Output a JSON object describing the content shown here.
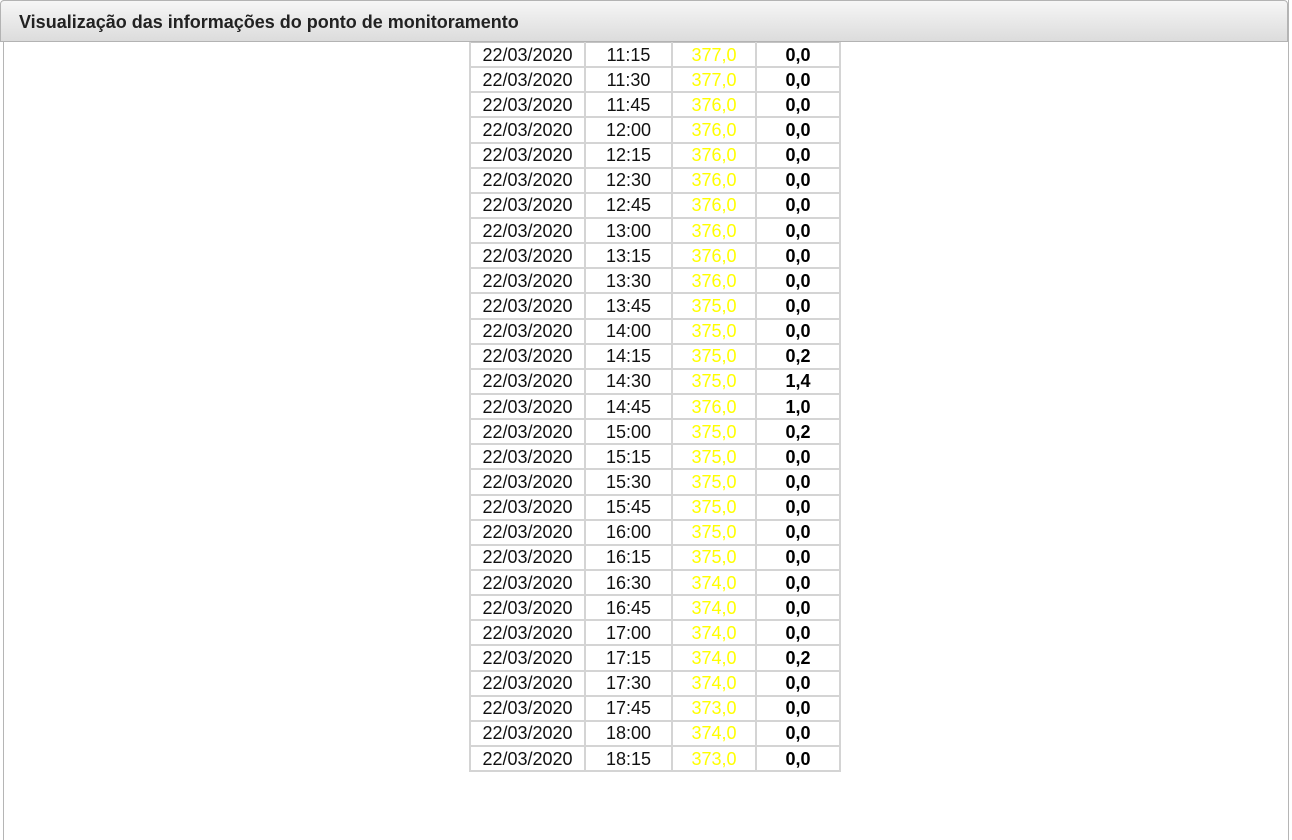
{
  "panel": {
    "title": "Visualização das informações do ponto de monitoramento"
  },
  "colors": {
    "level_text": "#ffff00",
    "header_bg": "#e6e6e6",
    "grid": "#d4d4d4"
  },
  "rows": [
    {
      "date": "22/03/2020",
      "time": "11:15",
      "level": "377,0",
      "rain": "0,0"
    },
    {
      "date": "22/03/2020",
      "time": "11:30",
      "level": "377,0",
      "rain": "0,0"
    },
    {
      "date": "22/03/2020",
      "time": "11:45",
      "level": "376,0",
      "rain": "0,0"
    },
    {
      "date": "22/03/2020",
      "time": "12:00",
      "level": "376,0",
      "rain": "0,0"
    },
    {
      "date": "22/03/2020",
      "time": "12:15",
      "level": "376,0",
      "rain": "0,0"
    },
    {
      "date": "22/03/2020",
      "time": "12:30",
      "level": "376,0",
      "rain": "0,0"
    },
    {
      "date": "22/03/2020",
      "time": "12:45",
      "level": "376,0",
      "rain": "0,0"
    },
    {
      "date": "22/03/2020",
      "time": "13:00",
      "level": "376,0",
      "rain": "0,0"
    },
    {
      "date": "22/03/2020",
      "time": "13:15",
      "level": "376,0",
      "rain": "0,0"
    },
    {
      "date": "22/03/2020",
      "time": "13:30",
      "level": "376,0",
      "rain": "0,0"
    },
    {
      "date": "22/03/2020",
      "time": "13:45",
      "level": "375,0",
      "rain": "0,0"
    },
    {
      "date": "22/03/2020",
      "time": "14:00",
      "level": "375,0",
      "rain": "0,0"
    },
    {
      "date": "22/03/2020",
      "time": "14:15",
      "level": "375,0",
      "rain": "0,2"
    },
    {
      "date": "22/03/2020",
      "time": "14:30",
      "level": "375,0",
      "rain": "1,4"
    },
    {
      "date": "22/03/2020",
      "time": "14:45",
      "level": "376,0",
      "rain": "1,0"
    },
    {
      "date": "22/03/2020",
      "time": "15:00",
      "level": "375,0",
      "rain": "0,2"
    },
    {
      "date": "22/03/2020",
      "time": "15:15",
      "level": "375,0",
      "rain": "0,0"
    },
    {
      "date": "22/03/2020",
      "time": "15:30",
      "level": "375,0",
      "rain": "0,0"
    },
    {
      "date": "22/03/2020",
      "time": "15:45",
      "level": "375,0",
      "rain": "0,0"
    },
    {
      "date": "22/03/2020",
      "time": "16:00",
      "level": "375,0",
      "rain": "0,0"
    },
    {
      "date": "22/03/2020",
      "time": "16:15",
      "level": "375,0",
      "rain": "0,0"
    },
    {
      "date": "22/03/2020",
      "time": "16:30",
      "level": "374,0",
      "rain": "0,0"
    },
    {
      "date": "22/03/2020",
      "time": "16:45",
      "level": "374,0",
      "rain": "0,0"
    },
    {
      "date": "22/03/2020",
      "time": "17:00",
      "level": "374,0",
      "rain": "0,0"
    },
    {
      "date": "22/03/2020",
      "time": "17:15",
      "level": "374,0",
      "rain": "0,2"
    },
    {
      "date": "22/03/2020",
      "time": "17:30",
      "level": "374,0",
      "rain": "0,0"
    },
    {
      "date": "22/03/2020",
      "time": "17:45",
      "level": "373,0",
      "rain": "0,0"
    },
    {
      "date": "22/03/2020",
      "time": "18:00",
      "level": "374,0",
      "rain": "0,0"
    },
    {
      "date": "22/03/2020",
      "time": "18:15",
      "level": "373,0",
      "rain": "0,0"
    }
  ]
}
